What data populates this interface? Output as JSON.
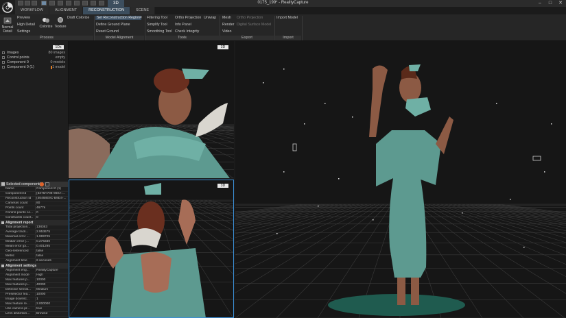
{
  "window": {
    "title": "0175_199* - RealityCapture",
    "context_tab": "3D",
    "controls": [
      "–",
      "□",
      "✕"
    ]
  },
  "tabs": [
    "WORKFLOW",
    "ALIGNMENT",
    "RECONSTRUCTION",
    "SCENE"
  ],
  "active_tab": "RECONSTRUCTION",
  "ribbon": {
    "process": {
      "label": "Process",
      "normal_detail": "Normal Detail",
      "preview": "Preview",
      "high_detail": "High Detail",
      "settings": "Settings",
      "colorize": "Colorize",
      "texture": "Texture",
      "draft_colorize": "Draft Colorize"
    },
    "model_alignment": {
      "label": "Model Alignment",
      "set_region": "Set Reconstruction Region",
      "define_ground": "Define Ground Plane",
      "reset_ground": "Reset Ground"
    },
    "tools": {
      "label": "Tools",
      "filtering": "Filtering Tool",
      "simplify": "Simplify Tool",
      "smoothing": "Smoothing Tool",
      "ortho": "Ortho Projection",
      "info": "Info Panel",
      "integrity": "Check Integrity",
      "unwrap": "Unwrap"
    },
    "export": {
      "label": "Export",
      "mesh": "Mesh",
      "render": "Render",
      "video": "Video",
      "ortho": "Ortho Projection",
      "dsm": "Digital Surface Model"
    },
    "import": {
      "label": "Import",
      "import_model": "Import Model"
    }
  },
  "left_panel": {
    "view_tag": "1Ds",
    "tree": [
      {
        "key": "Images",
        "value": "80 images"
      },
      {
        "key": "Control points",
        "value": "empty"
      },
      {
        "key": "Component 0",
        "value": "0 models"
      },
      {
        "key": "Component 0 (1)",
        "value": "1 model"
      }
    ]
  },
  "properties": {
    "header": "Selected component(s)",
    "rows": [
      {
        "k": "Name",
        "v": "Component 0 (1)"
      },
      {
        "k": "Component Id",
        "v": "{6378A708-960A-..."
      },
      {
        "k": "Reconstruction Id",
        "v": "{46468E9C-B9D4-..."
      },
      {
        "k": "Cameras count",
        "v": "80"
      },
      {
        "k": "Points count",
        "v": "4677k"
      },
      {
        "k": "Control points co...",
        "v": "0"
      },
      {
        "k": "Constraints count...",
        "v": "0"
      }
    ],
    "alignment_report": {
      "title": "Alignment report",
      "rows": [
        {
          "k": "Total projection...",
          "v": "138363"
        },
        {
          "k": "Average track...",
          "v": "2.953675"
        },
        {
          "k": "Maximal error ...",
          "v": "1.999725"
        },
        {
          "k": "Median error [...",
          "v": "0.276330"
        },
        {
          "k": "Mean error [pi...",
          "v": "0.401295"
        },
        {
          "k": "Geo-referenced",
          "v": "false"
        },
        {
          "k": "Metric",
          "v": "false"
        },
        {
          "k": "Alignment time",
          "v": "6 seconds"
        }
      ]
    },
    "alignment_settings": {
      "title": "Alignment settings",
      "rows": [
        {
          "k": "Alignment eng...",
          "v": "RealityCapture"
        },
        {
          "k": "Alignment mode",
          "v": "High"
        },
        {
          "k": "Max features p...",
          "v": "10000"
        },
        {
          "k": "Max features p...",
          "v": "40000"
        },
        {
          "k": "Detector sensiti...",
          "v": "Medium"
        },
        {
          "k": "Preselector fea...",
          "v": "10000"
        },
        {
          "k": "Image downsc...",
          "v": "1"
        },
        {
          "k": "Max feature re...",
          "v": "2.000000"
        },
        {
          "k": "Use camera pr...",
          "v": "true"
        },
        {
          "k": "Lens distortion...",
          "v": "Brown3"
        }
      ]
    }
  },
  "viewports": [
    {
      "tag": "3D"
    },
    {
      "tag": "3D"
    },
    {
      "tag": ""
    }
  ]
}
